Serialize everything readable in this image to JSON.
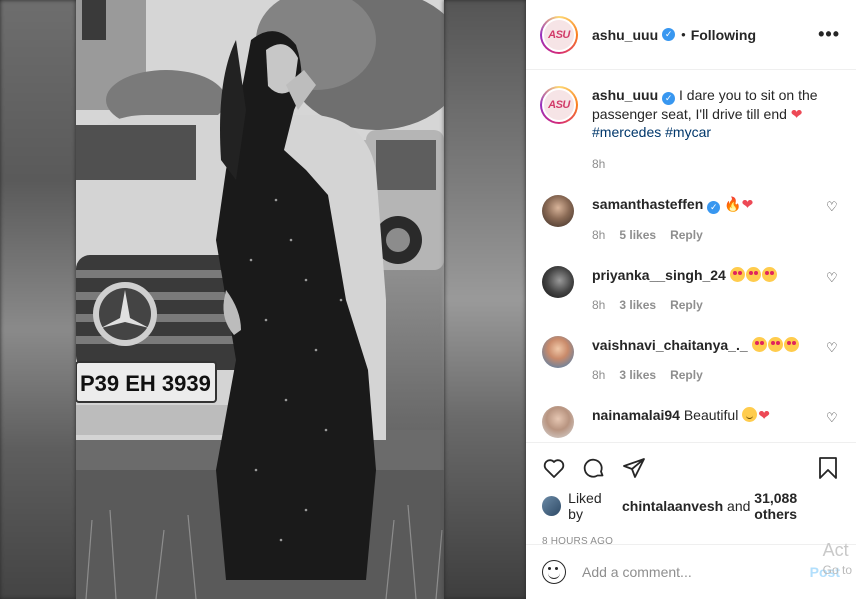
{
  "post": {
    "username": "ashu_uuu",
    "avatar_text": "ASU",
    "following_label": "Following",
    "more_label": "•••"
  },
  "caption": {
    "username": "ashu_uuu",
    "text": "I dare you to sit on the passenger seat, I'll drive till end",
    "hashtags": "#mercedes #mycar",
    "time": "8h"
  },
  "comments": [
    {
      "username": "samanthasteffen",
      "text": "",
      "time": "8h",
      "likes": "5 likes",
      "reply": "Reply"
    },
    {
      "username": "priyanka__singh_24",
      "text": "",
      "time": "8h",
      "likes": "3 likes",
      "reply": "Reply"
    },
    {
      "username": "vaishnavi_chaitanya_._",
      "text": "",
      "time": "8h",
      "likes": "3 likes",
      "reply": "Reply"
    },
    {
      "username": "nainamalai94",
      "text": "Beautiful",
      "time": "",
      "likes": "",
      "reply": ""
    }
  ],
  "likes": {
    "prefix": "Liked by",
    "user": "chintalaanvesh",
    "and": "and",
    "count": "31,088 others"
  },
  "posted_time": "8 HOURS AGO",
  "add_comment": {
    "placeholder": "Add a comment...",
    "post_label": "Post"
  },
  "watermark": {
    "line1": "Act",
    "line2": "Go to"
  },
  "photo": {
    "plate_text": "P39 EH 3939"
  },
  "colors": {
    "accent": "#3897f0",
    "heart": "#ed4956",
    "link": "#00376b"
  }
}
